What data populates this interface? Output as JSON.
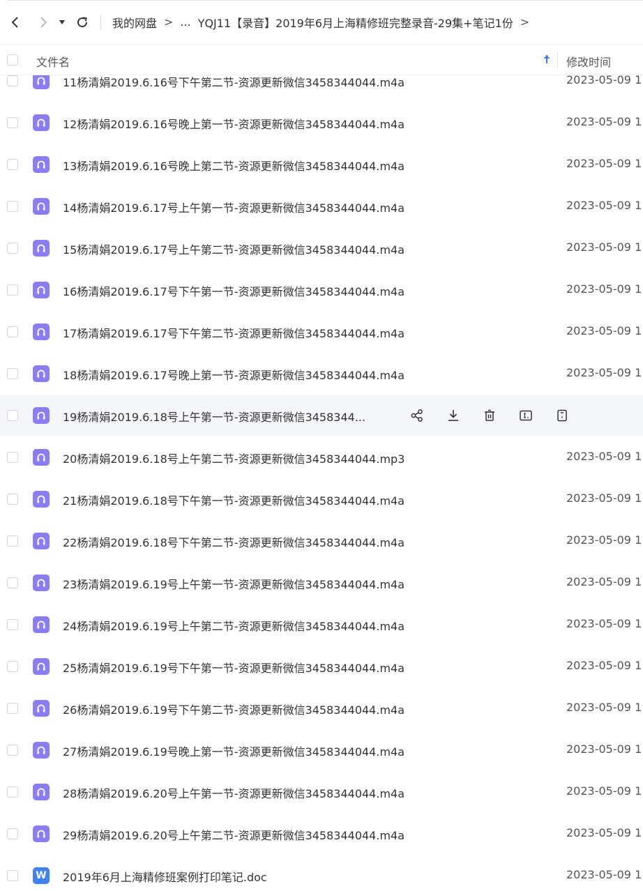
{
  "nav": {
    "breadcrumb": [
      "我的网盘",
      "...",
      "YQJ11【录音】2019年6月上海精修班完整录音-29集+笔记1份"
    ],
    "separator": ">"
  },
  "columns": {
    "name": "文件名",
    "modified": "修改时间"
  },
  "files": [
    {
      "name": "11杨清娟2019.6.16号下午第二节-资源更新微信3458344044.m4a",
      "time": "2023-05-09 1",
      "type": "audio"
    },
    {
      "name": "12杨清娟2019.6.16号晚上第一节-资源更新微信3458344044.m4a",
      "time": "2023-05-09 1",
      "type": "audio"
    },
    {
      "name": "13杨清娟2019.6.16号晚上第二节-资源更新微信3458344044.m4a",
      "time": "2023-05-09 1",
      "type": "audio"
    },
    {
      "name": "14杨清娟2019.6.17号上午第一节-资源更新微信3458344044.m4a",
      "time": "2023-05-09 1",
      "type": "audio"
    },
    {
      "name": "15杨清娟2019.6.17号上午第二节-资源更新微信3458344044.m4a",
      "time": "2023-05-09 1",
      "type": "audio"
    },
    {
      "name": "16杨清娟2019.6.17号下午第一节-资源更新微信3458344044.m4a",
      "time": "2023-05-09 1",
      "type": "audio"
    },
    {
      "name": "17杨清娟2019.6.17号下午第二节-资源更新微信3458344044.m4a",
      "time": "2023-05-09 1",
      "type": "audio"
    },
    {
      "name": "18杨清娟2019.6.17号晚上第一节-资源更新微信3458344044.m4a",
      "time": "2023-05-09 1",
      "type": "audio"
    },
    {
      "name": "19杨清娟2019.6.18号上午第一节-资源更新微信3458344...",
      "time": "",
      "type": "audio",
      "hovered": true
    },
    {
      "name": "20杨清娟2019.6.18号上午第二节-资源更新微信3458344044.mp3",
      "time": "2023-05-09 1",
      "type": "audio"
    },
    {
      "name": "21杨清娟2019.6.18号下午第一节-资源更新微信3458344044.m4a",
      "time": "2023-05-09 1",
      "type": "audio"
    },
    {
      "name": "22杨清娟2019.6.18号下午第二节-资源更新微信3458344044.m4a",
      "time": "2023-05-09 1",
      "type": "audio"
    },
    {
      "name": "23杨清娟2019.6.19号上午第一节-资源更新微信3458344044.m4a",
      "time": "2023-05-09 1",
      "type": "audio"
    },
    {
      "name": "24杨清娟2019.6.19号上午第二节-资源更新微信3458344044.m4a",
      "time": "2023-05-09 1",
      "type": "audio"
    },
    {
      "name": "25杨清娟2019.6.19号下午第一节-资源更新微信3458344044.m4a",
      "time": "2023-05-09 1",
      "type": "audio"
    },
    {
      "name": "26杨清娟2019.6.19号下午第二节-资源更新微信3458344044.m4a",
      "time": "2023-05-09 1",
      "type": "audio"
    },
    {
      "name": "27杨清娟2019.6.19号晚上第一节-资源更新微信3458344044.m4a",
      "time": "2023-05-09 1",
      "type": "audio"
    },
    {
      "name": "28杨清娟2019.6.20号上午第一节-资源更新微信3458344044.m4a",
      "time": "2023-05-09 1",
      "type": "audio"
    },
    {
      "name": "29杨清娟2019.6.20号上午第二节-资源更新微信3458344044.m4a",
      "time": "2023-05-09 1",
      "type": "audio"
    },
    {
      "name": "2019年6月上海精修班案例打印笔记.doc",
      "time": "2023-05-09 1",
      "type": "doc"
    }
  ],
  "doc_icon_letter": "W",
  "hover_actions": [
    "share-icon",
    "download-icon",
    "delete-icon",
    "rename-icon",
    "details-icon"
  ],
  "colors": {
    "audio_icon": "#8b7df8",
    "doc_icon": "#3d82f6",
    "sort_arrow": "#3d82f6",
    "hover_row": "#f5f6fa"
  }
}
